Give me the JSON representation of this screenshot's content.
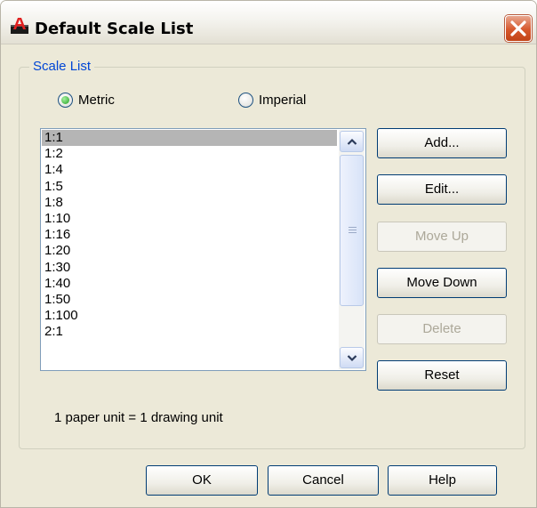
{
  "window": {
    "title": "Default Scale List",
    "app_icon": "autocad-app-icon",
    "close_icon": "close-icon"
  },
  "scale_list_group": {
    "legend": "Scale List",
    "units": {
      "metric_label": "Metric",
      "imperial_label": "Imperial",
      "selected": "Metric"
    },
    "items": [
      "1:1",
      "1:2",
      "1:4",
      "1:5",
      "1:8",
      "1:10",
      "1:16",
      "1:20",
      "1:30",
      "1:40",
      "1:50",
      "1:100",
      "2:1"
    ],
    "selected_item": "1:1",
    "buttons": {
      "add": "Add...",
      "edit": "Edit...",
      "move_up": "Move Up",
      "move_down": "Move Down",
      "delete": "Delete",
      "reset": "Reset"
    },
    "unit_note": "1 paper unit = 1 drawing unit"
  },
  "footer": {
    "ok": "OK",
    "cancel": "Cancel",
    "help": "Help"
  },
  "colors": {
    "legend": "#0046d5",
    "selection": "#b5b5b5",
    "dialog_bg": "#ece9d8",
    "close_button": "#d7582c"
  }
}
